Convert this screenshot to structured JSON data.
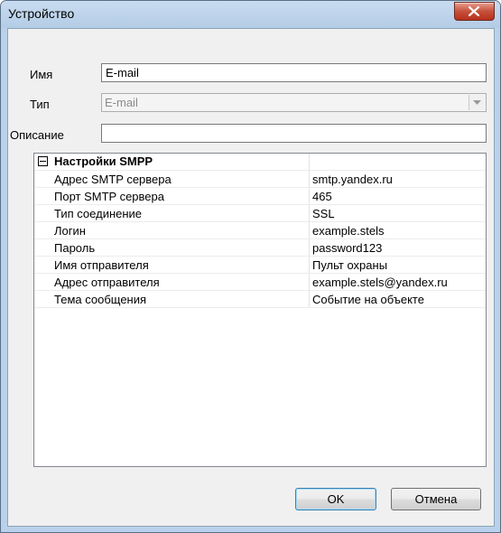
{
  "window": {
    "title": "Устройство"
  },
  "form": {
    "name_label": "Имя",
    "name_value": "E-mail",
    "type_label": "Тип",
    "type_value": "E-mail",
    "description_label": "Описание",
    "description_value": ""
  },
  "properties": {
    "category": "Настройки SMPP",
    "rows": [
      {
        "name": "Адрес SMTP сервера",
        "value": "smtp.yandex.ru"
      },
      {
        "name": "Порт SMTP сервера",
        "value": "465"
      },
      {
        "name": "Тип соединение",
        "value": "SSL"
      },
      {
        "name": "Логин",
        "value": "example.stels"
      },
      {
        "name": "Пароль",
        "value": "password123"
      },
      {
        "name": "Имя отправителя",
        "value": "Пульт охраны"
      },
      {
        "name": "Адрес отправителя",
        "value": "example.stels@yandex.ru"
      },
      {
        "name": "Тема сообщения",
        "value": "Событие на объекте"
      }
    ]
  },
  "buttons": {
    "ok": "OK",
    "cancel": "Отмена"
  }
}
